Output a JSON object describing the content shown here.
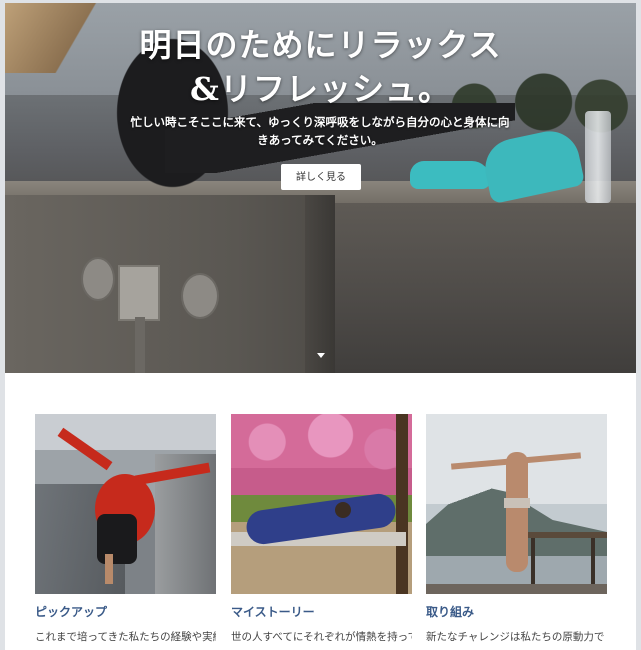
{
  "hero": {
    "title_line1": "明日のためにリラックス",
    "title_line2": "&リフレッシュ。",
    "subtitle": "忙しい時こそここに来て、ゆっくり深呼吸をしながら自分の心と身体に向きあってみてください。",
    "button_label": "詳しく見る"
  },
  "cards": [
    {
      "title": "ピックアップ",
      "text": "これまで培ってきた私たちの経験や実績"
    },
    {
      "title": "マイストーリー",
      "text": "世の人すべてにそれぞれが情熱を持って"
    },
    {
      "title": "取り組み",
      "text": "新たなチャレンジは私たちの原動力で"
    }
  ],
  "icons": {
    "scroll_down": "chevron-down-icon"
  },
  "colors": {
    "card_title": "#3a5a88",
    "button_bg": "#ffffff",
    "hero_text": "#ffffff"
  }
}
